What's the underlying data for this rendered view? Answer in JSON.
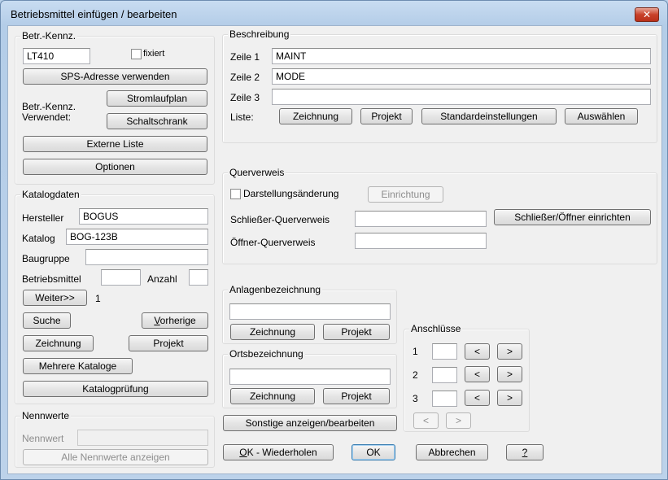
{
  "window": {
    "title": "Betriebsmittel einfügen / bearbeiten",
    "close_glyph": "✕"
  },
  "betr": {
    "title": "Betr.-Kennz.",
    "value": "LT410",
    "fixiert_label": "fixiert",
    "sps_button": "SPS-Adresse verwenden",
    "verwendet_label_1": "Betr.-Kennz.",
    "verwendet_label_2": "Verwendet:",
    "stromlaufplan_button": "Stromlaufplan",
    "schaltschrank_button": "Schaltschrank",
    "externe_liste_button": "Externe Liste",
    "optionen_button": "Optionen"
  },
  "katalog": {
    "title": "Katalogdaten",
    "hersteller_label": "Hersteller",
    "hersteller_value": "BOGUS",
    "katalog_label": "Katalog",
    "katalog_value": "BOG-123B",
    "baugruppe_label": "Baugruppe",
    "baugruppe_value": "",
    "betriebsmittel_label": "Betriebsmittel",
    "betriebsmittel_value": "",
    "anzahl_label": "Anzahl",
    "anzahl_value": "",
    "weiter_button": "Weiter>>",
    "weiter_count": "1",
    "suche_button": "Suche",
    "vorherige_underline": "V",
    "vorherige_rest": "orherige",
    "zeichnung_button": "Zeichnung",
    "projekt_button": "Projekt",
    "mehrere_button": "Mehrere Kataloge",
    "katalogpruefung_button": "Katalogprüfung"
  },
  "nennwerte": {
    "title": "Nennwerte",
    "nennwert_label": "Nennwert",
    "nennwert_value": "",
    "alle_button": "Alle Nennwerte anzeigen"
  },
  "beschreibung": {
    "title": "Beschreibung",
    "zeile1_label": "Zeile 1",
    "zeile1_value": "MAINT",
    "zeile2_label": "Zeile 2",
    "zeile2_value": "MODE",
    "zeile3_label": "Zeile 3",
    "zeile3_value": "",
    "liste_label": "Liste:",
    "zeichnung_button": "Zeichnung",
    "projekt_button": "Projekt",
    "standard_button": "Standardeinstellungen",
    "auswaehlen_button": "Auswählen"
  },
  "querverweis": {
    "title": "Querverweis",
    "darstellung_label": "Darstellungsänderung",
    "einrichtung_button": "Einrichtung",
    "schliesser_label": "Schließer-Querverweis",
    "schliesser_value": "",
    "schliesser_button": "Schließer/Öffner einrichten",
    "oeffner_label": "Öffner-Querverweis",
    "oeffner_value": ""
  },
  "anlagen": {
    "title": "Anlagenbezeichnung",
    "value": "",
    "zeichnung_button": "Zeichnung",
    "projekt_button": "Projekt"
  },
  "orts": {
    "title": "Ortsbezeichnung",
    "value": "",
    "zeichnung_button": "Zeichnung",
    "projekt_button": "Projekt"
  },
  "anschluesse": {
    "title": "Anschlüsse",
    "rows": [
      {
        "label": "1",
        "value": ""
      },
      {
        "label": "2",
        "value": ""
      },
      {
        "label": "3",
        "value": ""
      }
    ],
    "left_glyph": "<",
    "right_glyph": ">"
  },
  "sonstige_button": "Sonstige anzeigen/bearbeiten",
  "footer": {
    "ok_wiederholen_underline": "O",
    "ok_wiederholen_rest": "K - Wiederholen",
    "ok": "OK",
    "abbrechen": "Abbrechen",
    "help": "?"
  }
}
